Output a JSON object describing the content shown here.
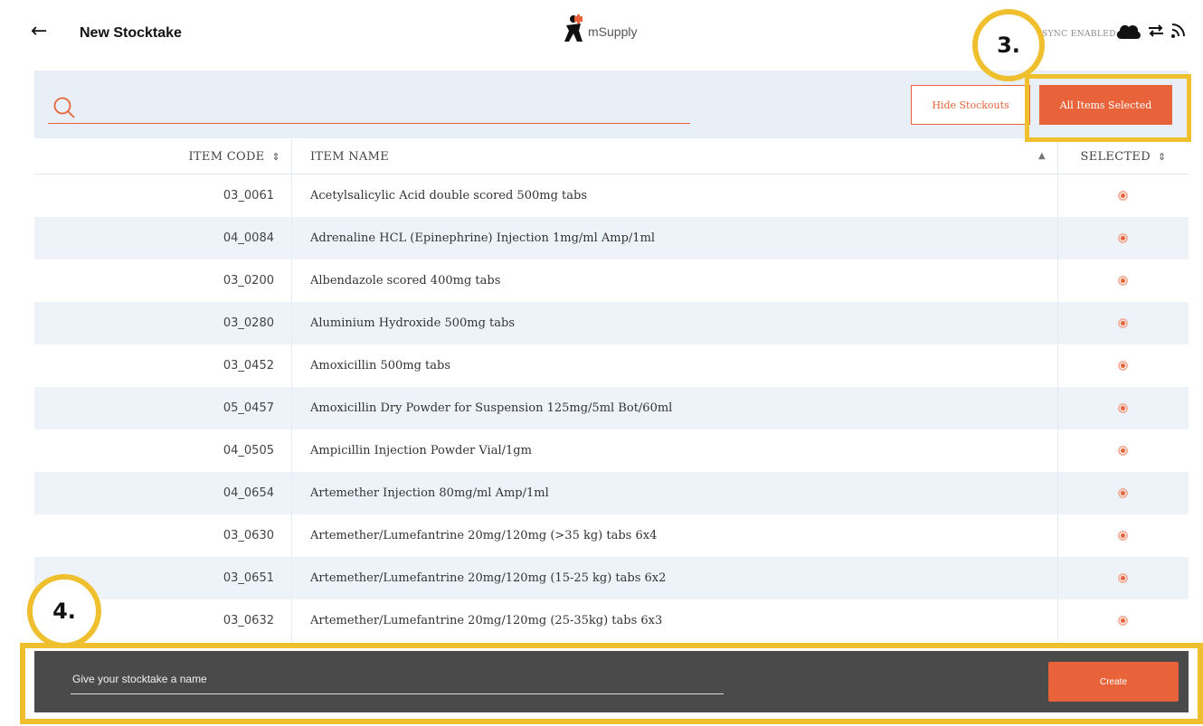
{
  "header": {
    "back_icon": "left-arrow-icon",
    "title": "New Stocktake",
    "logo_text": "mSupply",
    "sync_status": "SYNC ENABLED",
    "icons": [
      "cloud-icon",
      "sync-arrows-icon",
      "signal-icon"
    ]
  },
  "search": {
    "placeholder": "",
    "value": ""
  },
  "filters": {
    "hide_stockouts_label": "Hide Stockouts",
    "all_items_label": "All Items Selected"
  },
  "table": {
    "columns": {
      "code": "ITEM CODE",
      "name": "ITEM NAME",
      "selected": "SELECTED"
    },
    "rows": [
      {
        "code": "03_0061",
        "name": "Acetylsalicylic Acid double scored 500mg tabs",
        "selected": true
      },
      {
        "code": "04_0084",
        "name": "Adrenaline HCL (Epinephrine) Injection 1mg/ml Amp/1ml",
        "selected": true
      },
      {
        "code": "03_0200",
        "name": "Albendazole scored 400mg tabs",
        "selected": true
      },
      {
        "code": "03_0280",
        "name": "Aluminium Hydroxide 500mg tabs",
        "selected": true
      },
      {
        "code": "03_0452",
        "name": "Amoxicillin 500mg tabs",
        "selected": true
      },
      {
        "code": "05_0457",
        "name": "Amoxicillin Dry Powder for Suspension 125mg/5ml Bot/60ml",
        "selected": true
      },
      {
        "code": "04_0505",
        "name": "Ampicillin Injection Powder Vial/1gm",
        "selected": true
      },
      {
        "code": "04_0654",
        "name": "Artemether Injection 80mg/ml Amp/1ml",
        "selected": true
      },
      {
        "code": "03_0630",
        "name": "Artemether/Lumefantrine 20mg/120mg (>35 kg) tabs 6x4",
        "selected": true
      },
      {
        "code": "03_0651",
        "name": "Artemether/Lumefantrine 20mg/120mg (15-25 kg) tabs 6x2",
        "selected": true
      },
      {
        "code": "03_0632",
        "name": "Artemether/Lumefantrine 20mg/120mg (25-35kg) tabs 6x3",
        "selected": true
      }
    ]
  },
  "footer": {
    "name_placeholder": "Give your stocktake a name",
    "create_label": "Create"
  },
  "annotations": {
    "step3": "3.",
    "step4": "4."
  },
  "colors": {
    "accent": "#e8633a",
    "highlight": "#f0bf2e",
    "footer_bg": "#4a4a4a",
    "row_alt": "#eef3f9"
  }
}
